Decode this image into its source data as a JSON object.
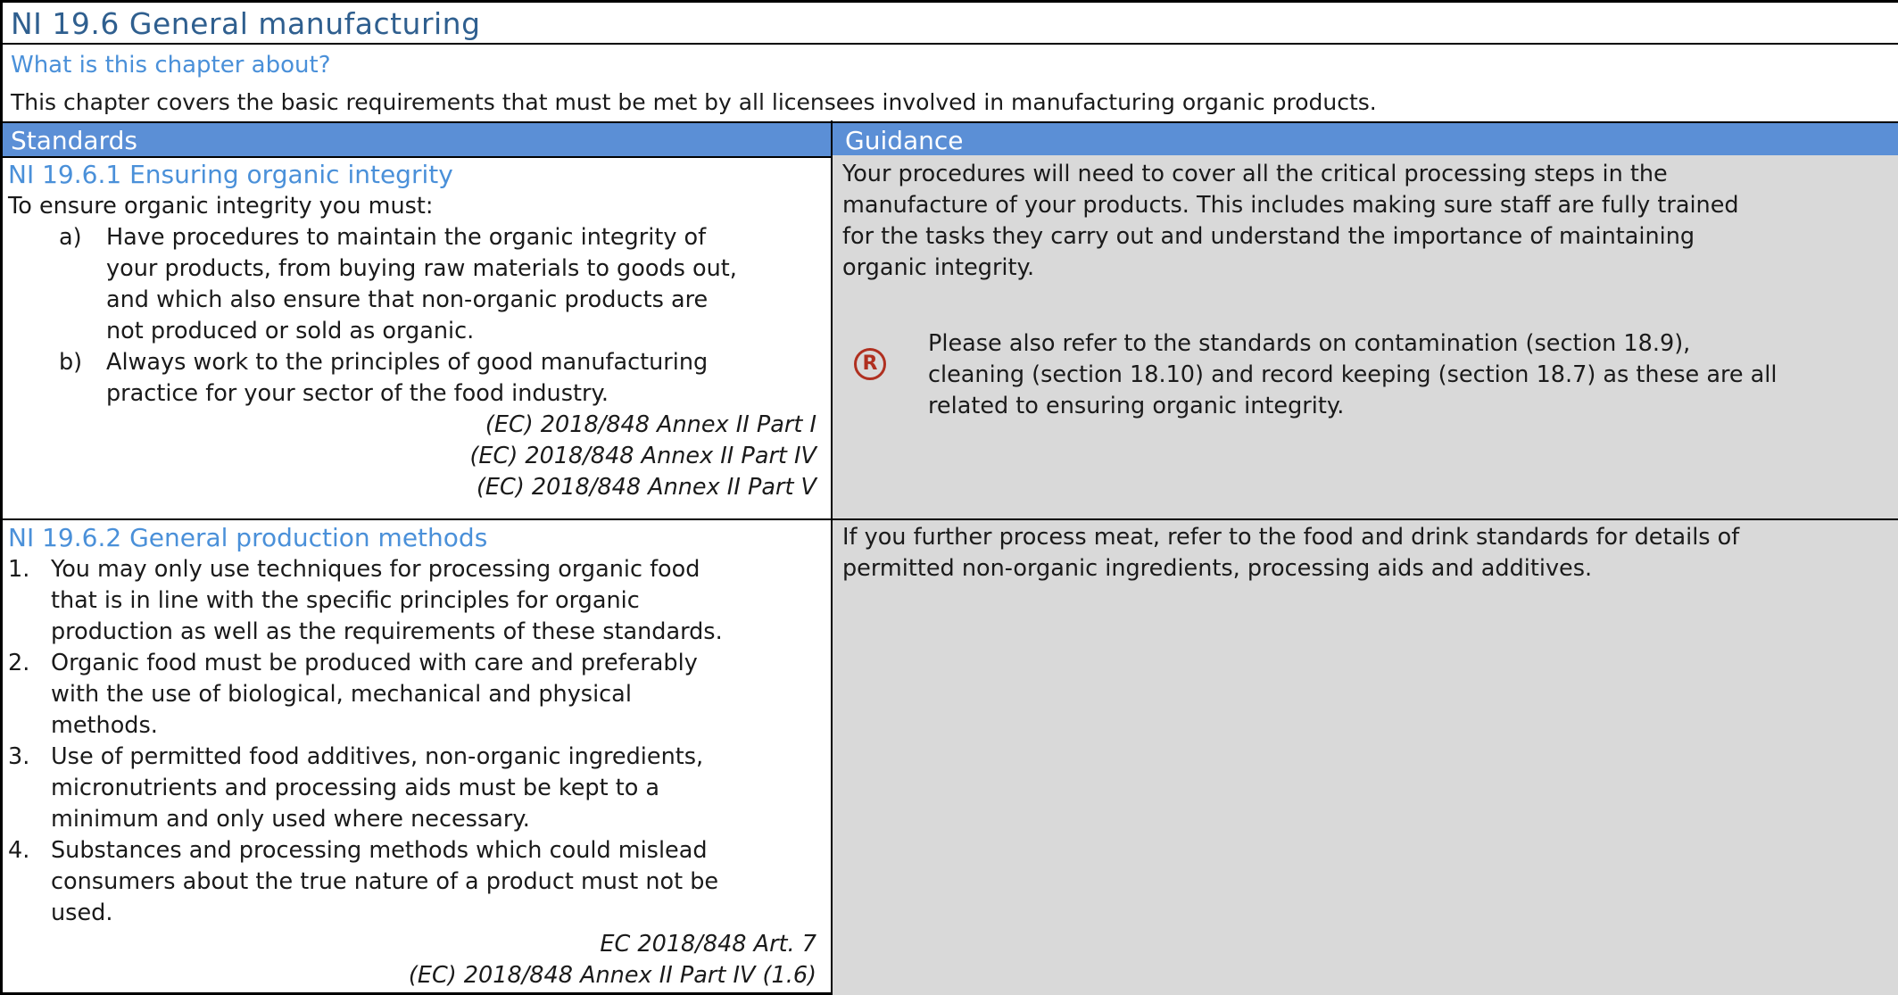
{
  "page_title": "NI 19.6 General manufacturing",
  "chapter_question": "What is this chapter about?",
  "chapter_intro": "This chapter covers the basic requirements that must be met by all licensees involved in manufacturing organic products.",
  "headers": {
    "standards": "Standards",
    "guidance": "Guidance"
  },
  "section1": {
    "title": "NI 19.6.1 Ensuring organic integrity",
    "lead": "To ensure organic integrity you must:",
    "items": [
      {
        "label": "a)",
        "lines": [
          "Have procedures to maintain the organic integrity of",
          "your products, from buying raw materials to goods out,",
          "and which also ensure that non-organic products are",
          "not produced or sold as organic."
        ]
      },
      {
        "label": "b)",
        "lines": [
          "Always work to the principles of good manufacturing",
          "practice for your sector of the food industry."
        ]
      }
    ],
    "refs": [
      "(EC) 2018/848 Annex II Part I",
      "(EC) 2018/848 Annex II Part IV",
      "(EC) 2018/848 Annex II Part V"
    ],
    "guidance_lines": [
      "Your procedures will need to cover all the critical processing steps in the",
      "manufacture of your products. This includes making sure staff are fully trained",
      "for the tasks they carry out and understand the importance of maintaining",
      "organic integrity."
    ],
    "note_icon": "registered-icon",
    "note_icon_glyph": "R",
    "note_lines": [
      "Please also refer to the standards on contamination (section 18.9),",
      "cleaning (section 18.10) and record keeping (section 18.7) as these are all",
      "related to ensuring organic integrity."
    ]
  },
  "section2": {
    "title": "NI 19.6.2 General production methods",
    "items": [
      {
        "label": "1.",
        "lines": [
          "You may only use techniques for processing organic food",
          "that is in line with the specific principles for organic",
          "production as well as the requirements of these standards."
        ]
      },
      {
        "label": "2.",
        "lines": [
          "Organic food must be produced with care and preferably",
          "with the use of biological, mechanical and physical",
          "methods."
        ]
      },
      {
        "label": "3.",
        "lines": [
          "Use of permitted food additives, non-organic ingredients,",
          "micronutrients and processing aids must be kept to a",
          "minimum and only used where necessary."
        ]
      },
      {
        "label": "4.",
        "lines": [
          "Substances and processing methods which could mislead",
          "consumers about the true nature of a product must not be",
          "used."
        ]
      }
    ],
    "refs": [
      "EC 2018/848 Art. 7",
      "(EC) 2018/848 Annex II Part IV (1.6)"
    ],
    "guidance_lines": [
      "If you further process meat, refer to the food and drink standards for details of",
      "permitted non-organic ingredients, processing aids and additives."
    ]
  },
  "colors": {
    "title": "#2f5f8f",
    "subhead": "#4a90d9",
    "header_bg": "#5b8fd6",
    "guidance_bg": "#d9d9d9",
    "icon": "#b03020"
  }
}
